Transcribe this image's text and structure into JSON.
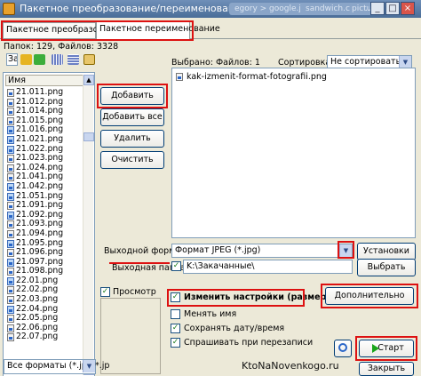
{
  "window": {
    "title": "Пакетное преобразование/переименование",
    "bg_tabs": [
      "egory > google.jpg",
      "sandwich.com...",
      "picture"
    ],
    "controls": {
      "minimize": "_",
      "maximize": "□",
      "close": "×"
    }
  },
  "tabs": [
    {
      "label": "Пакетное преобразование"
    },
    {
      "label": "Пакетное переименование"
    }
  ],
  "folder_info": "Папок: 129, Файлов: 3328",
  "toolbar": {
    "path_label": "За"
  },
  "file_list": {
    "column_header": "Имя",
    "items": [
      "21.011.png",
      "21.012.png",
      "21.014.png",
      "21.015.png",
      "21.016.png",
      "21.021.png",
      "21.022.png",
      "21.023.png",
      "21.024.png",
      "21.041.png",
      "21.042.png",
      "21.051.png",
      "21.091.png",
      "21.092.png",
      "21.093.png",
      "21.094.png",
      "21.095.png",
      "21.096.png",
      "21.097.png",
      "21.098.png",
      "22.01.png",
      "22.02.png",
      "22.03.png",
      "22.04.png",
      "22.05.png",
      "22.06.png",
      "22.07.png"
    ]
  },
  "buttons": {
    "add": "Добавить",
    "add_all": "Добавить все",
    "remove": "Удалить",
    "clear": "Очистить",
    "settings": "Установки",
    "browse": "Выбрать",
    "advanced": "Дополнительно",
    "start": "Старт",
    "close": "Закрыть"
  },
  "selection": {
    "label": "Выбрано: Файлов: 1"
  },
  "sort": {
    "label": "Сортировка:",
    "value": "Не сортировать"
  },
  "selected_files": [
    "kak-izmenit-format-fotografii.png"
  ],
  "output_format": {
    "label": "Выходной формат:",
    "value": "Формат JPEG (*.jpg)"
  },
  "output_folder": {
    "label": "Выходная папка:",
    "value": "K:\\Закачанные\\"
  },
  "preview": {
    "label": "Просмотр"
  },
  "options": [
    {
      "label": "Изменить настройки (размеры)...",
      "checked": true,
      "bold": true
    },
    {
      "label": "Менять имя",
      "checked": false,
      "bold": false
    },
    {
      "label": "Сохранять дату/время",
      "checked": true,
      "bold": false
    },
    {
      "label": "Спрашивать при перезаписи",
      "checked": true,
      "bold": false
    }
  ],
  "filter": {
    "value": "Все форматы (*.jpg;*.jp"
  },
  "watermark": "KtoNaNovenkogo.ru",
  "colors": {
    "highlight": "#dd1111",
    "title_bar": "#4a6d98",
    "start_icon": "#1aa51a"
  }
}
